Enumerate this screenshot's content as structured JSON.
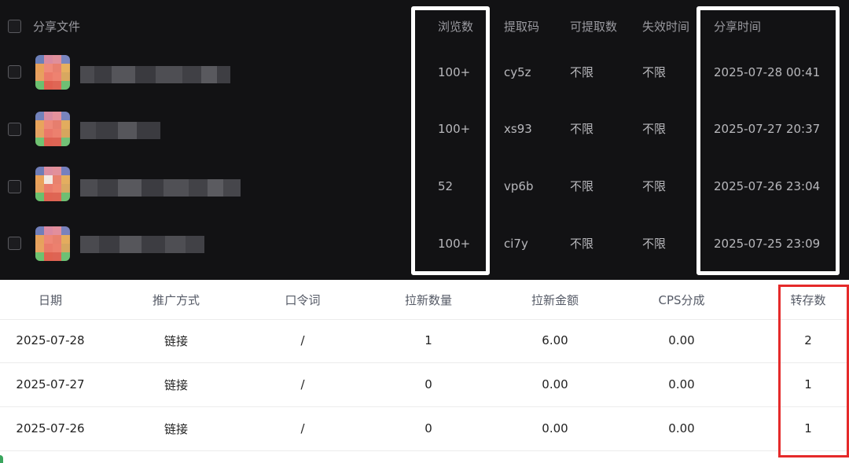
{
  "share_table": {
    "headers": {
      "file": "分享文件",
      "views": "浏览数",
      "code": "提取码",
      "extractable": "可提取数",
      "expiry": "失效时间",
      "share_time": "分享时间"
    },
    "rows": [
      {
        "views": "100+",
        "code": "cy5z",
        "extractable": "不限",
        "expiry": "不限",
        "share_time": "2025-07-28 00:41"
      },
      {
        "views": "100+",
        "code": "xs93",
        "extractable": "不限",
        "expiry": "不限",
        "share_time": "2025-07-27 20:37"
      },
      {
        "views": "52",
        "code": "vp6b",
        "extractable": "不限",
        "expiry": "不限",
        "share_time": "2025-07-26 23:04"
      },
      {
        "views": "100+",
        "code": "ci7y",
        "extractable": "不限",
        "expiry": "不限",
        "share_time": "2025-07-25 23:09"
      }
    ]
  },
  "stats_table": {
    "headers": {
      "date": "日期",
      "method": "推广方式",
      "password": "口令词",
      "new_count": "拉新数量",
      "new_amount": "拉新金额",
      "cps": "CPS分成",
      "saves": "转存数"
    },
    "rows": [
      {
        "date": "2025-07-28",
        "method": "链接",
        "password": "/",
        "new_count": "1",
        "new_amount": "6.00",
        "cps": "0.00",
        "saves": "2"
      },
      {
        "date": "2025-07-27",
        "method": "链接",
        "password": "/",
        "new_count": "0",
        "new_amount": "0.00",
        "cps": "0.00",
        "saves": "1"
      },
      {
        "date": "2025-07-26",
        "method": "链接",
        "password": "/",
        "new_count": "0",
        "new_amount": "0.00",
        "cps": "0.00",
        "saves": "1"
      }
    ]
  },
  "colors": {
    "dark_bg": "#121214",
    "highlight_white": "#ffffff",
    "highlight_red": "#e52a2a"
  }
}
